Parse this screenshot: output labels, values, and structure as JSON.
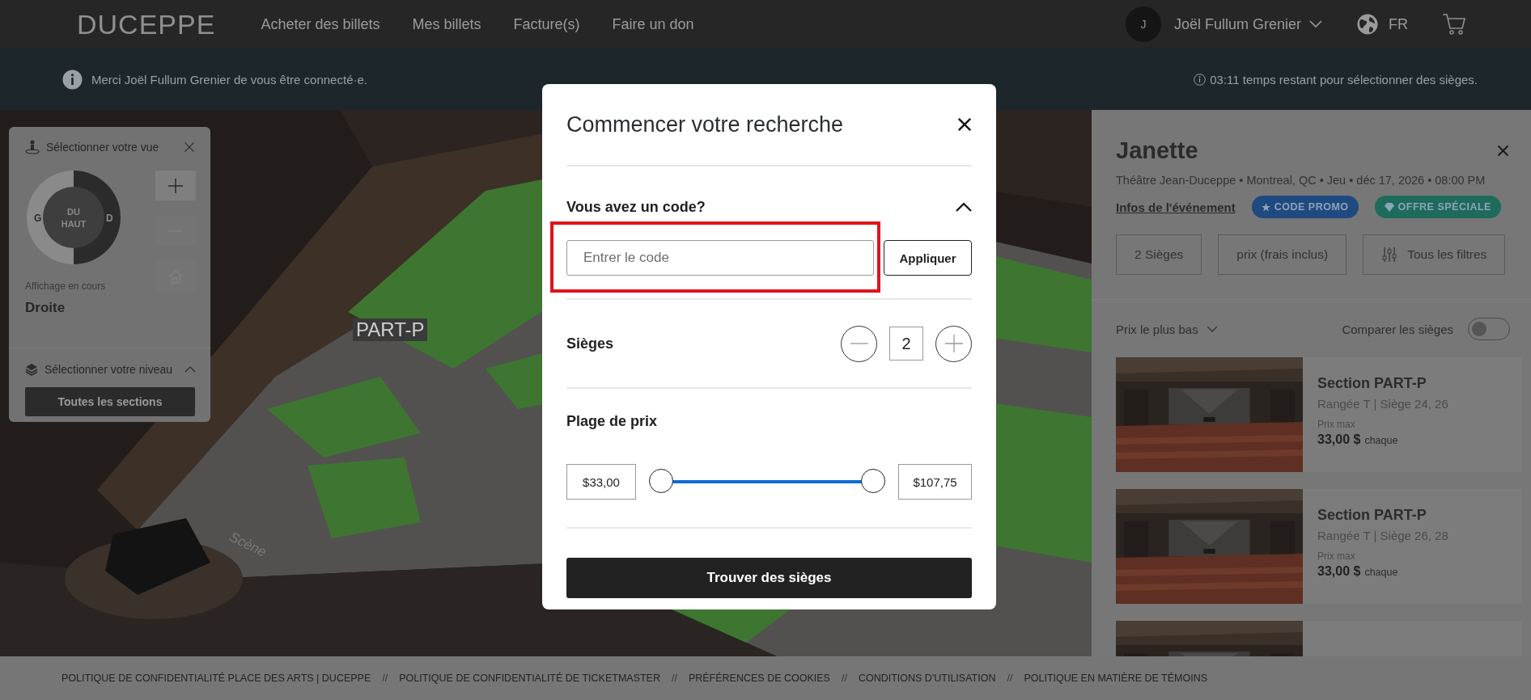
{
  "nav": {
    "logo": "DUCEPPE",
    "links": [
      "Acheter des billets",
      "Mes billets",
      "Facture(s)",
      "Faire un don"
    ],
    "user": {
      "initial": "J",
      "name": "Joël Fullum Grenier"
    },
    "language": "FR"
  },
  "info_bar": {
    "message": "Merci Joël Fullum Grenier de vous être connecté·e.",
    "timer": "03:11 temps restant pour sélectionner des sièges."
  },
  "view_panel": {
    "title": "Sélectionner votre vue",
    "dial": {
      "center": "DU HAUT",
      "sides": [
        {
          "label": "G",
          "selected": false
        },
        {
          "label": "D",
          "selected": true
        }
      ]
    },
    "zoom_controls": [
      {
        "kind": "plus",
        "disabled": false
      },
      {
        "kind": "minus",
        "disabled": true
      },
      {
        "kind": "home",
        "disabled": true
      }
    ],
    "current_label": "Affichage en cours",
    "current_value": "Droite",
    "level_title": "Sélectionner votre niveau",
    "level_expanded": true,
    "level_button": "Toutes les sections"
  },
  "map": {
    "section_label": "PART-P",
    "stage_label": "Scène"
  },
  "event_panel": {
    "title": "Janette",
    "details": "Théâtre Jean-Duceppe • Montreal, QC • Jeu • déc 17, 2026 • 08:00 PM",
    "link": "Infos de l'événement",
    "badges": [
      {
        "kind": "promo",
        "label": "CODE PROMO",
        "color": "#1f4a80"
      },
      {
        "kind": "offer",
        "label": "OFFRE SPÉCIALE",
        "color": "#1e6b5c"
      }
    ],
    "filters": [
      {
        "kind": "plain",
        "label": "2 Sièges"
      },
      {
        "kind": "plain",
        "label": "prix (frais inclus)"
      },
      {
        "kind": "all",
        "label": "Tous les filtres"
      }
    ],
    "sort": "Prix le plus bas",
    "compare": {
      "label": "Comparer les sièges",
      "on": false
    },
    "listings": [
      {
        "section": "Section PART-P",
        "seats": "Rangée T | Siège 24, 26",
        "price_label": "Prix max",
        "price": "33,00 $",
        "unit": "chaque"
      },
      {
        "section": "Section PART-P",
        "seats": "Rangée T | Siège 26, 28",
        "price_label": "Prix max",
        "price": "33,00 $",
        "unit": "chaque"
      }
    ]
  },
  "modal": {
    "title": "Commencer votre recherche",
    "code_section": {
      "heading": "Vous avez un code?",
      "expanded": true,
      "highlighted": true,
      "placeholder": "Entrer le code",
      "apply": "Appliquer"
    },
    "seats": {
      "label": "Sièges",
      "value": "2"
    },
    "price_range": {
      "label": "Plage de prix",
      "min": "$33,00",
      "max": "$107,75",
      "thumbs": [
        {
          "level": 0
        },
        {
          "level": 1
        }
      ]
    },
    "submit": "Trouver des sièges"
  },
  "footer": {
    "items": [
      {
        "kind": "link",
        "text": "POLITIQUE DE CONFIDENTIALITÉ PLACE DES ARTS | DUCEPPE"
      },
      {
        "kind": "separator",
        "text": "//"
      },
      {
        "kind": "link",
        "text": "POLITIQUE DE CONFIDENTIALITÉ DE TICKETMASTER"
      },
      {
        "kind": "separator",
        "text": "//"
      },
      {
        "kind": "link",
        "text": "PRÉFÉRENCES DE COOKIES"
      },
      {
        "kind": "separator",
        "text": "//"
      },
      {
        "kind": "link",
        "text": "CONDITIONS D'UTILISATION"
      },
      {
        "kind": "separator",
        "text": "//"
      },
      {
        "kind": "link",
        "text": "POLITIQUE EN MATIÈRE DE TÉMOINS"
      }
    ]
  }
}
